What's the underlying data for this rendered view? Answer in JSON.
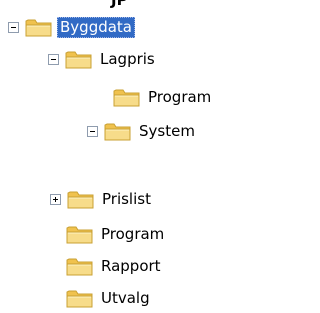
{
  "top_fragment": "JP",
  "tree": {
    "items": [
      {
        "label": "Byggdata",
        "expander": "minus",
        "selected": true
      },
      {
        "label": "Lagpris",
        "expander": "minus",
        "selected": false
      },
      {
        "label": "Program",
        "expander": "none",
        "selected": false
      },
      {
        "label": "System",
        "expander": "minus",
        "selected": false
      },
      {
        "label": "Prislist",
        "expander": "plus",
        "selected": false
      },
      {
        "label": "Program",
        "expander": "none",
        "selected": false
      },
      {
        "label": "Rapport",
        "expander": "none",
        "selected": false
      },
      {
        "label": "Utvalg",
        "expander": "none",
        "selected": false
      }
    ]
  },
  "colors": {
    "selection": "#316ac5",
    "folder_fill": "#f5d77a",
    "folder_tab": "#f0c24e",
    "folder_outline": "#c9a033"
  },
  "icons": {
    "folder": "folder-icon",
    "expand": "plus-box-icon",
    "collapse": "minus-box-icon"
  }
}
